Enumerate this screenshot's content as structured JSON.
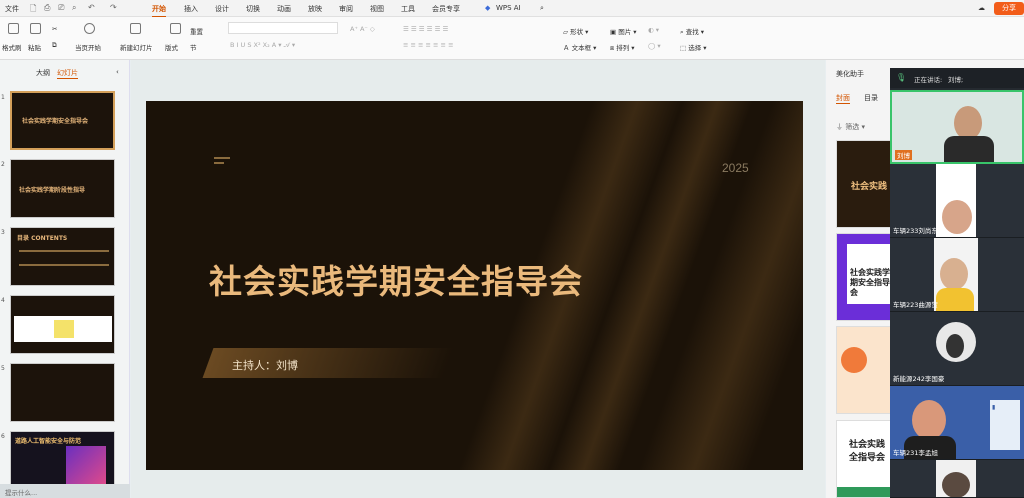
{
  "menu": {
    "file": "文件",
    "tabs": [
      "开始",
      "插入",
      "设计",
      "切换",
      "动画",
      "放映",
      "审阅",
      "视图",
      "工具",
      "会员专享"
    ],
    "wps_ai": "WPS AI",
    "share": "分享"
  },
  "ribbon": {
    "format_painter": "格式刷",
    "paste": "粘贴",
    "from_current": "当页开始",
    "new_slide": "新建幻灯片",
    "layout": "版式",
    "reset": "重置",
    "section": "节",
    "shape": "形状",
    "picture": "图片",
    "textbox": "文本框",
    "arrange": "排列",
    "find": "查找",
    "select": "选择"
  },
  "left_panel": {
    "tab_outline": "大纲",
    "tab_slides": "幻灯片",
    "thumbs": [
      {
        "num": "1",
        "title": "社会实践学期安全指导会"
      },
      {
        "num": "2",
        "title": "社会实践学期阶段性指导"
      },
      {
        "num": "3",
        "title": "目录 CONTENTS"
      },
      {
        "num": "4",
        "title": ""
      },
      {
        "num": "5",
        "title": ""
      },
      {
        "num": "6",
        "title": "道路人工智能安全与防范"
      }
    ],
    "status": "提示什么..."
  },
  "slide": {
    "year": "2025",
    "title": "社会实践学期安全指导会",
    "host": "主持人：刘博"
  },
  "right_panel": {
    "title": "美化助手",
    "tab_cover": "封面",
    "tab_toc": "目录",
    "filter": "筛选",
    "thumb_texts": [
      "社会实践",
      "社会实践学期安全指导会",
      "社会实践全指导会"
    ]
  },
  "conference": {
    "speaking_label": "正在讲话:",
    "speaking_name": "刘博;",
    "participants": [
      {
        "name": "刘博"
      },
      {
        "name": "车辆233刘尚东"
      },
      {
        "name": "车辆223曲源贺"
      },
      {
        "name": "新能源242李国豪"
      },
      {
        "name": "车辆231李孟旭"
      }
    ]
  },
  "colors": {
    "accent": "#d35400",
    "slide_bg": "#1b1208",
    "gold": "#e8b26a",
    "panel_dark": "#252a30"
  }
}
